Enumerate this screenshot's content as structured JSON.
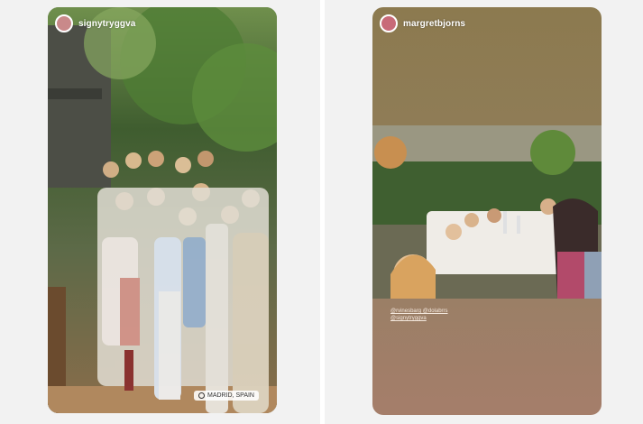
{
  "left_story": {
    "username": "signytryggva",
    "location_sticker": "MADRID, SPAIN",
    "photo_description_icon": "group-photo"
  },
  "right_story": {
    "username": "margretbjorns",
    "mentions": [
      "@rvinesbarg @dolabrrs",
      "@signytryggva"
    ],
    "photo_description_icon": "restaurant-photo"
  },
  "colors": {
    "page_bg": "#f2f2f2",
    "story_right_top": "#8c7a4f",
    "story_right_bottom": "#a57e6a"
  }
}
